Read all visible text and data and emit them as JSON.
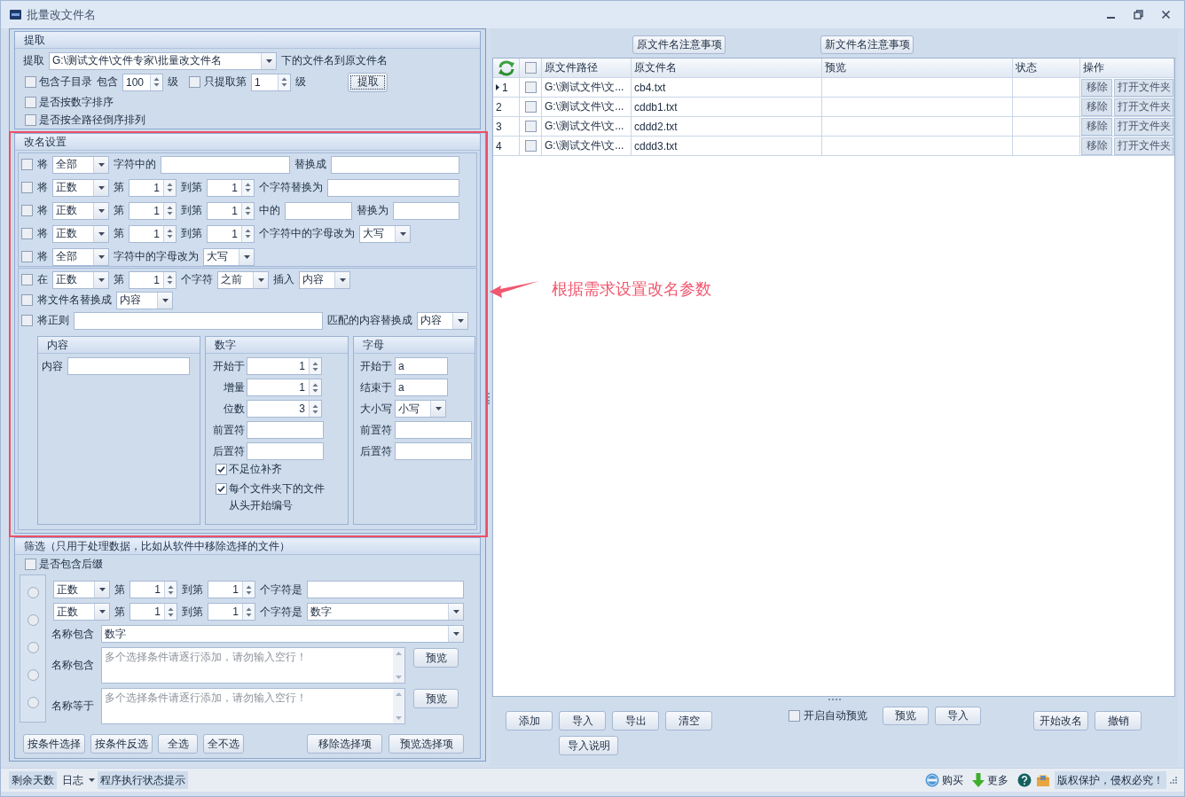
{
  "window": {
    "title": "批量改文件名"
  },
  "extract": {
    "title": "提取",
    "label": "提取",
    "path": "G:\\测试文件\\文件专家\\批量改文件名",
    "path_suffix": "下的文件名到原文件名",
    "subdirs": {
      "label": "包含子目录",
      "checked": false,
      "depth_label": "包含",
      "depth": "100",
      "unit": "级"
    },
    "only_level": {
      "label": "只提取第",
      "checked": false,
      "value": "1",
      "unit": "级"
    },
    "button": "提取",
    "options": [
      {
        "label": "是否按数字排序",
        "checked": false
      },
      {
        "label": "是否按全路径倒序排列",
        "checked": false
      }
    ]
  },
  "rename": {
    "title": "改名设置",
    "panels": [
      {
        "rules": [
          {
            "checked": false,
            "label": "将",
            "parts": [
              {
                "kind": "select",
                "value": "全部"
              },
              {
                "kind": "text",
                "text": "字符中的"
              },
              {
                "kind": "input"
              },
              {
                "kind": "text",
                "text": "替换成"
              },
              {
                "kind": "input"
              }
            ]
          },
          {
            "checked": false,
            "label": "将",
            "parts": [
              {
                "kind": "select",
                "value": "正数"
              },
              {
                "kind": "text",
                "text": "第"
              },
              {
                "kind": "spin",
                "value": "1"
              },
              {
                "kind": "text",
                "text": "到第"
              },
              {
                "kind": "spin",
                "value": "1"
              },
              {
                "kind": "text",
                "text": "个字符替换为"
              },
              {
                "kind": "input"
              }
            ]
          },
          {
            "checked": false,
            "label": "将",
            "parts": [
              {
                "kind": "select",
                "value": "正数"
              },
              {
                "kind": "text",
                "text": "第"
              },
              {
                "kind": "spin",
                "value": "1"
              },
              {
                "kind": "text",
                "text": "到第"
              },
              {
                "kind": "spin",
                "value": "1"
              },
              {
                "kind": "text",
                "text": "中的"
              },
              {
                "kind": "input"
              },
              {
                "kind": "text",
                "text": "替换为"
              },
              {
                "kind": "input"
              }
            ]
          },
          {
            "checked": false,
            "label": "将",
            "parts": [
              {
                "kind": "select",
                "value": "正数"
              },
              {
                "kind": "text",
                "text": "第"
              },
              {
                "kind": "spin",
                "value": "1"
              },
              {
                "kind": "text",
                "text": "到第"
              },
              {
                "kind": "spin",
                "value": "1"
              },
              {
                "kind": "text",
                "text": "个字符中的字母改为"
              },
              {
                "kind": "select",
                "value": "大写"
              }
            ]
          },
          {
            "checked": false,
            "label": "将",
            "parts": [
              {
                "kind": "select",
                "value": "全部"
              },
              {
                "kind": "text",
                "text": "字符中的字母改为"
              },
              {
                "kind": "select",
                "value": "大写"
              }
            ]
          }
        ]
      },
      {
        "rules": [
          {
            "checked": false,
            "label": "在",
            "parts": [
              {
                "kind": "select",
                "value": "正数"
              },
              {
                "kind": "text",
                "text": "第"
              },
              {
                "kind": "spin",
                "value": "1"
              },
              {
                "kind": "text",
                "text": "个字符"
              },
              {
                "kind": "select",
                "value": "之前"
              },
              {
                "kind": "text",
                "text": "插入"
              },
              {
                "kind": "select",
                "value": "内容"
              }
            ]
          },
          {
            "checked": false,
            "label": "将文件名替换成",
            "parts": [
              {
                "kind": "select",
                "value": "内容"
              }
            ]
          },
          {
            "checked": false,
            "label": "将正则",
            "parts": [
              {
                "kind": "input"
              },
              {
                "kind": "text",
                "text": "匹配的内容替换成"
              },
              {
                "kind": "select",
                "value": "内容"
              }
            ]
          }
        ]
      }
    ],
    "sources": [
      {
        "kind": "content",
        "title": "内容",
        "fields": [
          {
            "kind": "input",
            "label": "内容"
          }
        ]
      },
      {
        "kind": "number",
        "title": "数字",
        "fields": [
          {
            "kind": "spin",
            "label": "开始于",
            "value": "1"
          },
          {
            "kind": "spin",
            "label": "增量",
            "value": "1"
          },
          {
            "kind": "spin",
            "label": "位数",
            "value": "3"
          },
          {
            "kind": "input",
            "label": "前置符"
          },
          {
            "kind": "input",
            "label": "后置符"
          }
        ],
        "options": [
          {
            "label": "不足位补齐",
            "checked": true
          },
          {
            "label": "每个文件夹下的文件从头开始编号",
            "checked": true
          }
        ]
      },
      {
        "kind": "letter",
        "title": "字母",
        "fields": [
          {
            "kind": "input",
            "label": "开始于",
            "value": "a"
          },
          {
            "kind": "input",
            "label": "结束于",
            "value": "a"
          },
          {
            "kind": "select",
            "label": "大小写",
            "value": "小写"
          },
          {
            "kind": "input",
            "label": "前置符"
          },
          {
            "kind": "input",
            "label": "后置符"
          }
        ]
      }
    ]
  },
  "filter": {
    "title": "筛选（只用于处理数据，比如从软件中移除选择的文件）",
    "suffix_option": {
      "label": "是否包含后缀",
      "checked": false
    },
    "conditions": [
      {
        "selected": false,
        "parts": [
          {
            "kind": "select",
            "value": "正数"
          },
          {
            "kind": "text",
            "text": "第"
          },
          {
            "kind": "spin",
            "value": "1"
          },
          {
            "kind": "text",
            "text": "到第"
          },
          {
            "kind": "spin",
            "value": "1"
          },
          {
            "kind": "text",
            "text": "个字符是"
          },
          {
            "kind": "input"
          }
        ]
      },
      {
        "selected": false,
        "parts": [
          {
            "kind": "select",
            "value": "正数"
          },
          {
            "kind": "text",
            "text": "第"
          },
          {
            "kind": "spin",
            "value": "1"
          },
          {
            "kind": "text",
            "text": "到第"
          },
          {
            "kind": "spin",
            "value": "1"
          },
          {
            "kind": "text",
            "text": "个字符是"
          },
          {
            "kind": "select",
            "value": "数字"
          }
        ]
      },
      {
        "selected": false,
        "parts": [
          {
            "kind": "text",
            "text": "名称包含"
          },
          {
            "kind": "select",
            "value": "数字"
          }
        ]
      },
      {
        "selected": false,
        "parts": [
          {
            "kind": "text",
            "text": "名称包含"
          },
          {
            "kind": "textarea",
            "placeholder": "多个选择条件请逐行添加，请勿输入空行！"
          },
          {
            "kind": "button",
            "text": "预览"
          }
        ]
      },
      {
        "selected": false,
        "parts": [
          {
            "kind": "text",
            "text": "名称等于"
          },
          {
            "kind": "textarea",
            "placeholder": "多个选择条件请逐行添加，请勿输入空行！"
          },
          {
            "kind": "button",
            "text": "预览"
          }
        ]
      }
    ],
    "selection_buttons": [
      "按条件选择",
      "按条件反选",
      "全选",
      "全不选"
    ],
    "action_buttons": [
      "移除选择项",
      "预览选择项"
    ]
  },
  "files": {
    "notes": [
      "原文件名注意事项",
      "新文件名注意事项"
    ],
    "all_checked": false,
    "columns": [
      "原文件路径",
      "原文件名",
      "预览",
      "状态",
      "操作"
    ],
    "rows": [
      {
        "number": "1",
        "current": true,
        "checked": false,
        "path": "G:\\测试文件\\文...",
        "name": "cb4.txt",
        "actions": [
          "移除",
          "打开文件夹"
        ]
      },
      {
        "number": "2",
        "current": false,
        "checked": false,
        "path": "G:\\测试文件\\文...",
        "name": "cddb1.txt",
        "actions": [
          "移除",
          "打开文件夹"
        ]
      },
      {
        "number": "3",
        "current": false,
        "checked": false,
        "path": "G:\\测试文件\\文...",
        "name": "cddd2.txt",
        "actions": [
          "移除",
          "打开文件夹"
        ]
      },
      {
        "number": "4",
        "current": false,
        "checked": false,
        "path": "G:\\测试文件\\文...",
        "name": "cddd3.txt",
        "actions": [
          "移除",
          "打开文件夹"
        ]
      }
    ]
  },
  "file_actions": {
    "edit_buttons": [
      "添加",
      "导入",
      "导出",
      "清空"
    ],
    "import_help": "导入说明",
    "auto_preview": {
      "label": "开启自动预览",
      "checked": false
    },
    "preview_buttons": [
      "预览",
      "导入"
    ],
    "run_buttons": [
      "开始改名",
      "撤销"
    ]
  },
  "annotation": {
    "text": "根据需求设置改名参数"
  },
  "status_bar": {
    "left": [
      {
        "kind": "label",
        "text": "剩余天数"
      },
      {
        "kind": "menu",
        "text": "日志"
      },
      {
        "kind": "label",
        "text": "程序执行状态提示"
      }
    ],
    "right": [
      {
        "kind": "link",
        "text": "购买"
      },
      {
        "kind": "link",
        "text": "更多"
      },
      {
        "kind": "label",
        "text": "版权保护，侵权必究！"
      }
    ]
  }
}
